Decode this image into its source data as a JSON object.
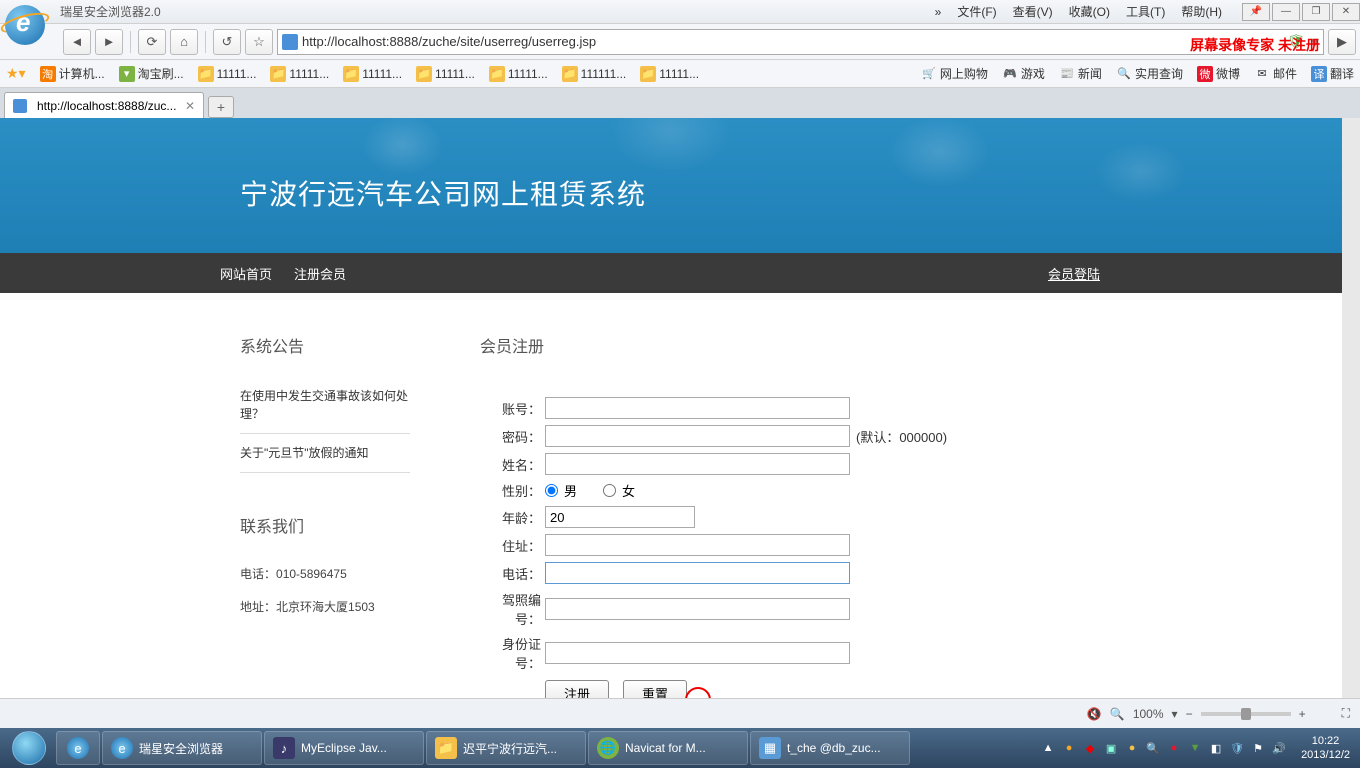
{
  "window": {
    "title": "瑞星安全浏览器2.0",
    "menus": [
      "»",
      "文件(F)",
      "查看(V)",
      "收藏(O)",
      "工具(T)",
      "帮助(H)"
    ]
  },
  "watermark": "屏幕录像专家 未注册",
  "url": "http://localhost:8888/zuche/site/userreg/userreg.jsp",
  "bookmarks": {
    "left": [
      "计算机...",
      "淘宝刷...",
      "11111...",
      "11111...",
      "11111...",
      "11111...",
      "11111...",
      "111111...",
      "11111..."
    ],
    "right": [
      "网上购物",
      "游戏",
      "新闻",
      "实用查询",
      "微博",
      "邮件",
      "翻译"
    ]
  },
  "tab": {
    "title": "http://localhost:8888/zuc..."
  },
  "site": {
    "title": "宁波行远汽车公司网上租赁系统",
    "nav": {
      "home": "网站首页",
      "register": "注册会员",
      "login": "会员登陆"
    }
  },
  "sidebar": {
    "notice_title": "系统公告",
    "notices": [
      "在使用中发生交通事故该如何处理？",
      "关于\"元旦节\"放假的通知"
    ],
    "contact_title": "联系我们",
    "phone_label": "电话：",
    "phone": "010-5896475",
    "addr_label": "地址：",
    "addr": "北京环海大厦1503"
  },
  "form": {
    "title": "会员注册",
    "labels": {
      "account": "账号：",
      "password": "密码：",
      "name": "姓名：",
      "gender": "性别：",
      "age": "年龄：",
      "address": "住址：",
      "phone": "电话：",
      "license": "驾照编号：",
      "idcard": "身份证号："
    },
    "password_hint": "(默认：000000)",
    "gender_male": "男",
    "gender_female": "女",
    "age_value": "20",
    "btn_submit": "注册",
    "btn_reset": "重置"
  },
  "status": {
    "zoom": "100%"
  },
  "taskbar": {
    "items": [
      "瑞星安全浏览器",
      "MyEclipse Jav...",
      "迟平宁波行远汽...",
      "Navicat for M...",
      "t_che @db_zuc..."
    ],
    "time": "10:22",
    "date": "2013/12/2"
  }
}
